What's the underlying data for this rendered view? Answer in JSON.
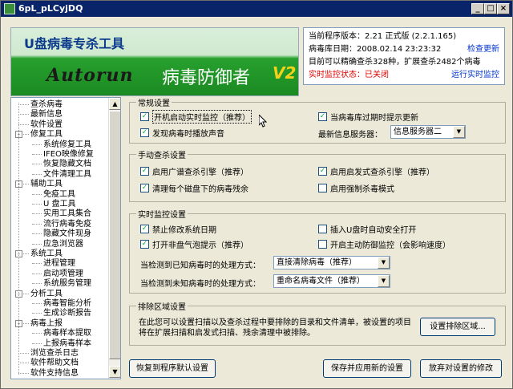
{
  "window": {
    "title": "6pL_pLCyjDQ",
    "controls": [
      "_",
      "□",
      "×"
    ]
  },
  "banner": {
    "tool_title": "U盘病毒专杀工具",
    "logo_text": "Autorun",
    "product_name": "病毒防御者",
    "version_badge": "V2"
  },
  "info": {
    "version_line": "当前程序版本：2.21 正式版 (2.2.1.165)",
    "db_date_line": "病毒库日期：2008.02.14 23:23:32",
    "check_update": "检查更新",
    "capability_line": "目前可以精确查杀328种，扩展查杀2482个病毒",
    "monitor_status": "实时监控状态：已关闭",
    "run_monitor": "运行实时监控"
  },
  "tree": {
    "items": [
      {
        "label": "查杀病毒",
        "level": 0
      },
      {
        "label": "最新信息",
        "level": 0
      },
      {
        "label": "软件设置",
        "level": 0
      },
      {
        "label": "修复工具",
        "level": 0,
        "expander": "-"
      },
      {
        "label": "系统修复工具",
        "level": 1
      },
      {
        "label": "IFEO映像修复",
        "level": 1
      },
      {
        "label": "恢复隐藏文档",
        "level": 1
      },
      {
        "label": "文件清理工具",
        "level": 1
      },
      {
        "label": "辅助工具",
        "level": 0,
        "expander": "-"
      },
      {
        "label": "免疫工具",
        "level": 1
      },
      {
        "label": "U 盘工具",
        "level": 1
      },
      {
        "label": "实用工具集合",
        "level": 1
      },
      {
        "label": "流行病毒免疫",
        "level": 1
      },
      {
        "label": "隐藏文件现身",
        "level": 1
      },
      {
        "label": "应急浏览器",
        "level": 1
      },
      {
        "label": "系统工具",
        "level": 0,
        "expander": "-"
      },
      {
        "label": "进程管理",
        "level": 1
      },
      {
        "label": "启动项管理",
        "level": 1
      },
      {
        "label": "系统服务管理",
        "level": 1
      },
      {
        "label": "分析工具",
        "level": 0,
        "expander": "-"
      },
      {
        "label": "病毒智能分析",
        "level": 1
      },
      {
        "label": "生成诊断报告",
        "level": 1
      },
      {
        "label": "病毒上报",
        "level": 0,
        "expander": "-"
      },
      {
        "label": "病毒样本提取",
        "level": 1
      },
      {
        "label": "上报病毒样本",
        "level": 1
      },
      {
        "label": "浏览查杀日志",
        "level": 0
      },
      {
        "label": "软件帮助文档",
        "level": 0
      },
      {
        "label": "软件支持信息",
        "level": 0
      }
    ]
  },
  "general": {
    "title": "常规设置",
    "autostart_monitor": {
      "label": "开机启动实时监控（推荐）",
      "checked": true
    },
    "expired_prompt": {
      "label": "当病毒库过期时提示更新",
      "checked": true
    },
    "found_sound": {
      "label": "发现病毒时播放声音",
      "checked": true
    },
    "server_label": "最新信息服务器：",
    "server_value": "信息服务器二"
  },
  "manual": {
    "title": "手动查杀设置",
    "wide_engine": {
      "label": "启用广谱查杀引擎（推荐）",
      "checked": true
    },
    "heuristic_engine": {
      "label": "启用启发式查杀引擎（推荐）",
      "checked": true
    },
    "clean_residue": {
      "label": "清理每个磁盘下的病毒残余",
      "checked": true
    },
    "force_delete": {
      "label": "启用强制杀毒模式",
      "checked": false
    }
  },
  "realtime": {
    "title": "实时监控设置",
    "block_date": {
      "label": "禁止修改系统日期",
      "checked": true
    },
    "usb_safe_open": {
      "label": "插入U盘时自动安全打开",
      "checked": false
    },
    "open_drive_prompt": {
      "label": "打开非盘气泡提示（推荐）",
      "checked": true
    },
    "active_defense": {
      "label": "开启主动防御监控（会影响速度）",
      "checked": false
    },
    "known_label": "当检测到已知病毒时的处理方式：",
    "known_value": "直接清除病毒（推荐）",
    "unknown_label": "当检测到未知病毒时的处理方式：",
    "unknown_value": "重命名病毒文件（推荐）"
  },
  "exclude": {
    "title": "排除区域设置",
    "description": "在此您可以设置扫描以及查杀过程中要排除的目录和文件清单，被设置的项目将在扩展扫描和启发式扫描、残余清理中被排除。",
    "button": "设置排除区域..."
  },
  "footer": {
    "restore_default": "恢复到程序默认设置",
    "save_apply": "保存并应用新的设置",
    "discard": "放弃对设置的修改"
  },
  "colors": {
    "titlebar": "#0a246a",
    "link": "#0033cc",
    "alert": "#e00000",
    "banner_green": "#1b8a22",
    "version_badge": "#f5d21a"
  }
}
